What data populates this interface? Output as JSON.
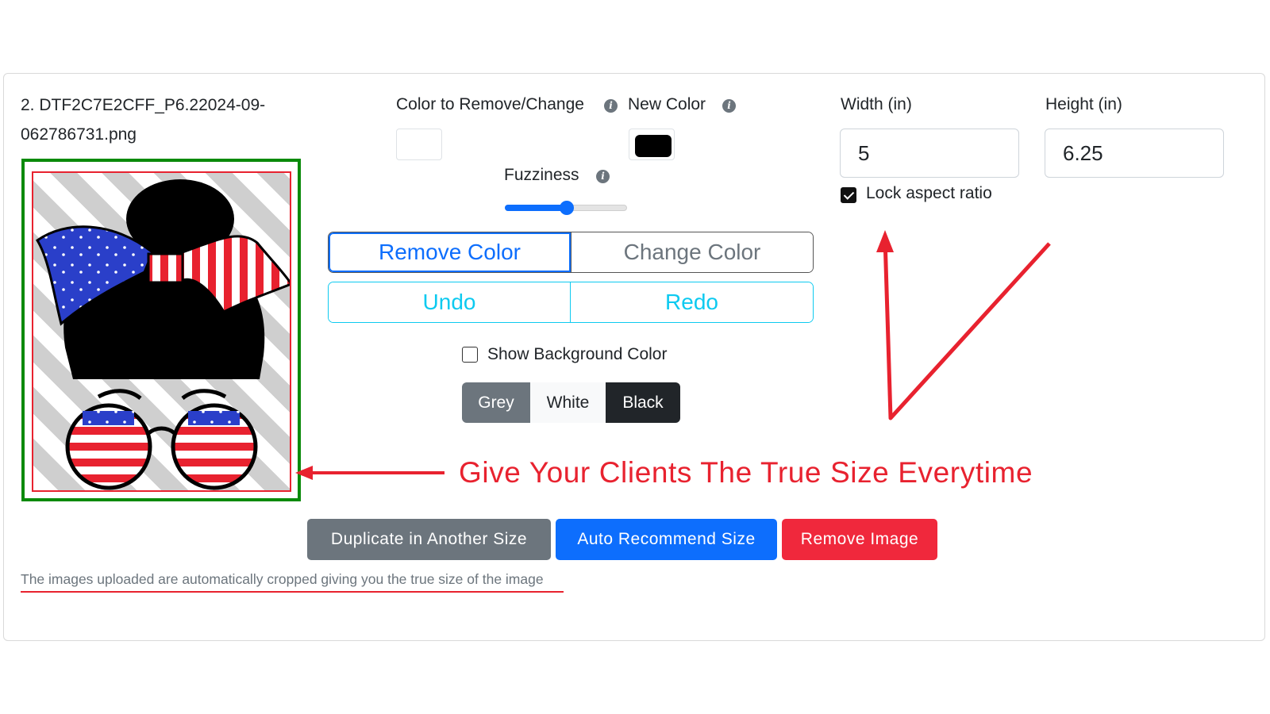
{
  "item": {
    "filename": "2. DTF2C7E2CFF_P6.22024-09-062786731.png"
  },
  "color_tools": {
    "remove_label": "Color to Remove/Change",
    "new_color_label": "New Color",
    "remove_swatch_color": "#ffffff",
    "new_swatch_color": "#000000",
    "fuzziness_label": "Fuzziness",
    "fuzziness_level": 0.5,
    "info_icon_glyph": "i"
  },
  "mode_buttons": {
    "remove": "Remove Color",
    "change": "Change Color",
    "active": "remove"
  },
  "history_buttons": {
    "undo": "Undo",
    "redo": "Redo"
  },
  "background": {
    "show_label": "Show Background Color",
    "show_checked": false,
    "options": [
      "Grey",
      "White",
      "Black"
    ]
  },
  "size": {
    "width_label": "Width (in)",
    "width_value": "5",
    "height_label": "Height (in)",
    "height_value": "6.25",
    "lock_label": "Lock aspect ratio",
    "lock_checked": true
  },
  "annotation": {
    "text": "Give Your Clients The True Size Everytime",
    "color": "#e8222f"
  },
  "actions": {
    "duplicate": "Duplicate in Another Size",
    "auto": "Auto Recommend Size",
    "remove": "Remove Image"
  },
  "footnote": "The images uploaded are automatically cropped giving you the true size of the image",
  "colors": {
    "primary": "#0d6efd",
    "info": "#0dcaf0",
    "secondary": "#6c757d",
    "danger": "#f0283c",
    "preview_border": "#0a8a0a"
  }
}
